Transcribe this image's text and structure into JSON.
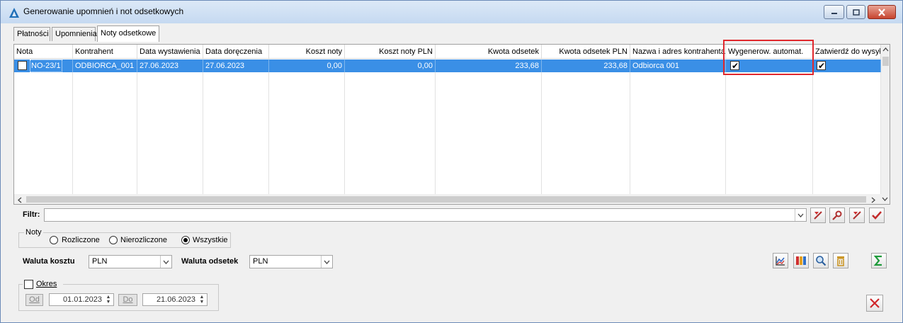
{
  "window": {
    "title": "Generowanie upomnień i not odsetkowych"
  },
  "tabs": [
    {
      "label": "Płatności"
    },
    {
      "label": "Upomnienia"
    },
    {
      "label": "Noty odsetkowe",
      "active": true
    }
  ],
  "grid": {
    "columns": [
      "Nota",
      "Kontrahent",
      "Data wystawienia",
      "Data doręczenia",
      "Koszt noty",
      "Koszt noty PLN",
      "Kwota odsetek",
      "Kwota odsetek PLN",
      "Nazwa i adres kontrahenta",
      "Wygenerow. automat.",
      "Zatwierdź do wysył"
    ],
    "rows": [
      {
        "checked": false,
        "nota": "NO-23/1",
        "kontrahent": "ODBIORCA_001",
        "data_wystawienia": "27.06.2023",
        "data_doreczenia": "27.06.2023",
        "koszt_noty": "0,00",
        "koszt_noty_pln": "0,00",
        "kwota_odsetek": "233,68",
        "kwota_odsetek_pln": "233,68",
        "nazwa": "Odbiorca 001",
        "wygenerow": true,
        "zatwierdz": true
      }
    ]
  },
  "filter": {
    "label": "Filtr:",
    "value": ""
  },
  "noty": {
    "legend": "Noty",
    "options": [
      "Rozliczone",
      "Nierozliczone",
      "Wszystkie"
    ],
    "selected": "Wszystkie"
  },
  "waluta_kosztu": {
    "label": "Waluta kosztu",
    "value": "PLN"
  },
  "waluta_odsetek": {
    "label": "Waluta odsetek",
    "value": "PLN"
  },
  "okres": {
    "label": "Okres",
    "checked": false,
    "od_label": "Od",
    "od_value": "01.01.2023",
    "do_label": "Do",
    "do_value": "21.06.2023"
  },
  "colors": {
    "selection": "#3a8fe6",
    "highlight_box": "#e0282d"
  }
}
